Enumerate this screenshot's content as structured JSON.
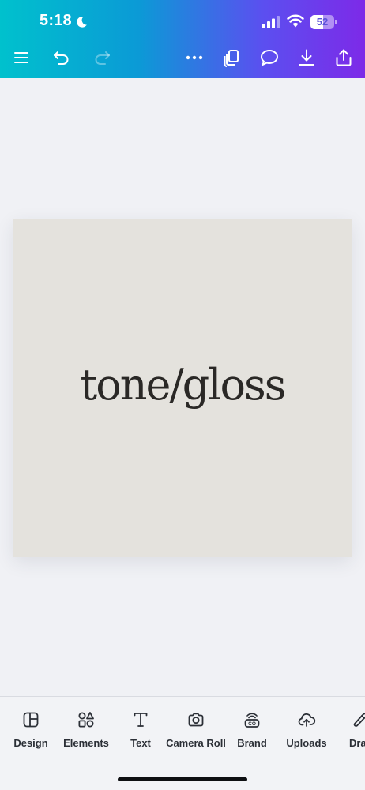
{
  "status_bar": {
    "time": "5:18",
    "battery_level": "52",
    "battery_fraction": 0.52,
    "icons": [
      "moon-icon",
      "cellular-signal-icon",
      "wifi-icon",
      "battery-icon"
    ]
  },
  "toolbar": {
    "left_icons": [
      "menu-icon",
      "undo-icon",
      "redo-icon"
    ],
    "right_icons": [
      "more-options-icon",
      "pages-icon",
      "comment-icon",
      "download-icon",
      "share-icon"
    ],
    "redo_enabled": false
  },
  "canvas": {
    "background_color": "#e4e2dd",
    "text": "tone/gloss",
    "text_color": "#2a2826"
  },
  "bottom_tabs": [
    {
      "label": "Design",
      "icon": "layout-icon"
    },
    {
      "label": "Elements",
      "icon": "shapes-icon"
    },
    {
      "label": "Text",
      "icon": "text-icon"
    },
    {
      "label": "Camera Roll",
      "icon": "camera-icon"
    },
    {
      "label": "Brand",
      "icon": "brand-icon"
    },
    {
      "label": "Uploads",
      "icon": "cloud-upload-icon"
    },
    {
      "label": "Dra",
      "icon": "draw-icon"
    }
  ],
  "colors": {
    "header_gradient": [
      "#00c1cd",
      "#0b9ad6",
      "#5b4ff0",
      "#7d2ae8"
    ],
    "workspace_bg": "#f0f1f5",
    "tab_bar_bg": "#f2f3f6"
  }
}
